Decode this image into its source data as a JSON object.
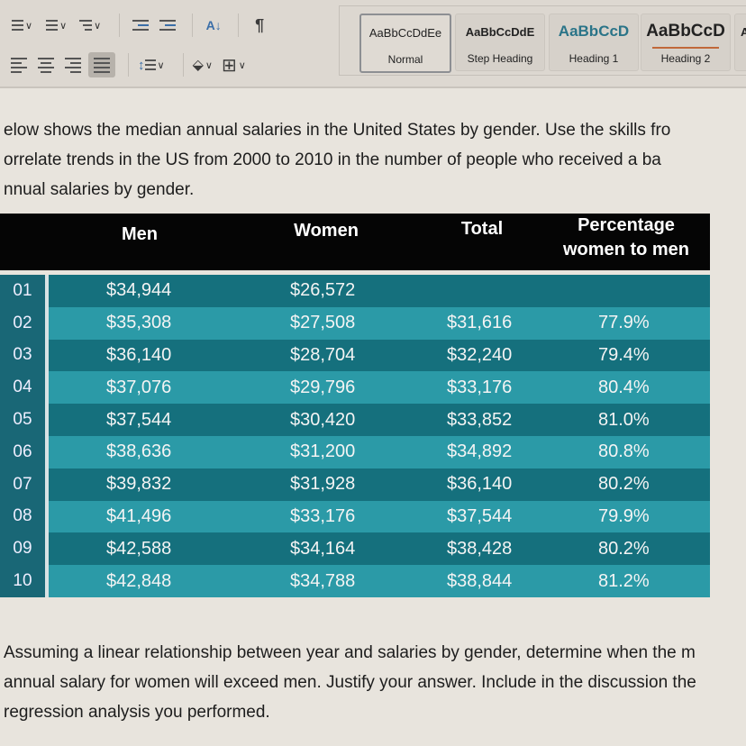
{
  "toolbar": {
    "row1": [
      {
        "name": "bullets-list",
        "icon": "bullet-list-icon",
        "dropdown": true
      },
      {
        "name": "numbered-list",
        "icon": "numbered-list-icon",
        "dropdown": true
      },
      {
        "name": "multilevel-list",
        "icon": "multilevel-list-icon",
        "dropdown": true
      },
      {
        "name": "decrease-indent",
        "icon": "decrease-indent-icon",
        "dropdown": false
      },
      {
        "name": "increase-indent",
        "icon": "increase-indent-icon",
        "dropdown": false
      },
      {
        "name": "sort",
        "icon": "sort-az-icon",
        "dropdown": false
      },
      {
        "name": "show-formatting",
        "icon": "pilcrow-icon",
        "dropdown": false
      }
    ],
    "row2": [
      {
        "name": "align-left",
        "icon": "align-left-icon"
      },
      {
        "name": "align-center",
        "icon": "align-center-icon"
      },
      {
        "name": "align-right",
        "icon": "align-right-icon"
      },
      {
        "name": "justify",
        "icon": "justify-icon",
        "active": true
      },
      {
        "name": "line-spacing",
        "icon": "line-spacing-icon"
      },
      {
        "name": "shading",
        "icon": "paint-bucket-icon"
      },
      {
        "name": "borders",
        "icon": "borders-icon"
      }
    ],
    "glyphs": {
      "sort": "A↓",
      "pilcrow": "¶",
      "chevron": "∨",
      "paint": "⬙",
      "borders": "⊞",
      "spacing": "↕"
    }
  },
  "styles_gallery": {
    "items": [
      {
        "preview": "AaBbCcDdEe",
        "name": "Normal",
        "selected": true
      },
      {
        "preview": "AaBbCcDdE",
        "name": "Step Heading",
        "selected": false
      },
      {
        "preview": "AaBbCcD",
        "name": "Heading 1",
        "selected": false
      },
      {
        "preview": "AaBbCcD",
        "name": "Heading 2",
        "selected": false
      },
      {
        "preview": "A",
        "name": "",
        "selected": false
      }
    ]
  },
  "document": {
    "intro_lines": [
      "elow shows the median annual salaries in the United States by gender. Use the skills fro",
      "orrelate trends in the US from 2000 to 2010 in the number of people who received a ba",
      "nnual salaries by gender."
    ],
    "question_lines": [
      "Assuming a linear relationship between year and salaries by gender, determine when the m",
      "annual salary for women will exceed men.  Justify your answer. Include in the discussion the",
      "regression analysis you performed."
    ]
  },
  "table": {
    "headers": {
      "men": "Men",
      "women": "Women",
      "total": "Total",
      "pct_line1": "Percentage",
      "pct_line2": "women to men"
    },
    "rows": [
      {
        "year": "01",
        "men": "$34,944",
        "women": "$26,572",
        "total": "",
        "pct": ""
      },
      {
        "year": "02",
        "men": "$35,308",
        "women": "$27,508",
        "total": "$31,616",
        "pct": "77.9%"
      },
      {
        "year": "03",
        "men": "$36,140",
        "women": "$28,704",
        "total": "$32,240",
        "pct": "79.4%"
      },
      {
        "year": "04",
        "men": "$37,076",
        "women": "$29,796",
        "total": "$33,176",
        "pct": "80.4%"
      },
      {
        "year": "05",
        "men": "$37,544",
        "women": "$30,420",
        "total": "$33,852",
        "pct": "81.0%"
      },
      {
        "year": "06",
        "men": "$38,636",
        "women": "$31,200",
        "total": "$34,892",
        "pct": "80.8%"
      },
      {
        "year": "07",
        "men": "$39,832",
        "women": "$31,928",
        "total": "$36,140",
        "pct": "80.2%"
      },
      {
        "year": "08",
        "men": "$41,496",
        "women": "$33,176",
        "total": "$37,544",
        "pct": "79.9%"
      },
      {
        "year": "09",
        "men": "$42,588",
        "women": "$34,164",
        "total": "$38,428",
        "pct": "80.2%"
      },
      {
        "year": "10",
        "men": "$42,848",
        "women": "$34,788",
        "total": "$38,844",
        "pct": "81.2%"
      }
    ]
  },
  "colors": {
    "header_bg": "#050505",
    "row_dark": "#15707d",
    "row_light": "#2b9aa7",
    "year_col": "#196776",
    "heading1": "#2a7488"
  }
}
